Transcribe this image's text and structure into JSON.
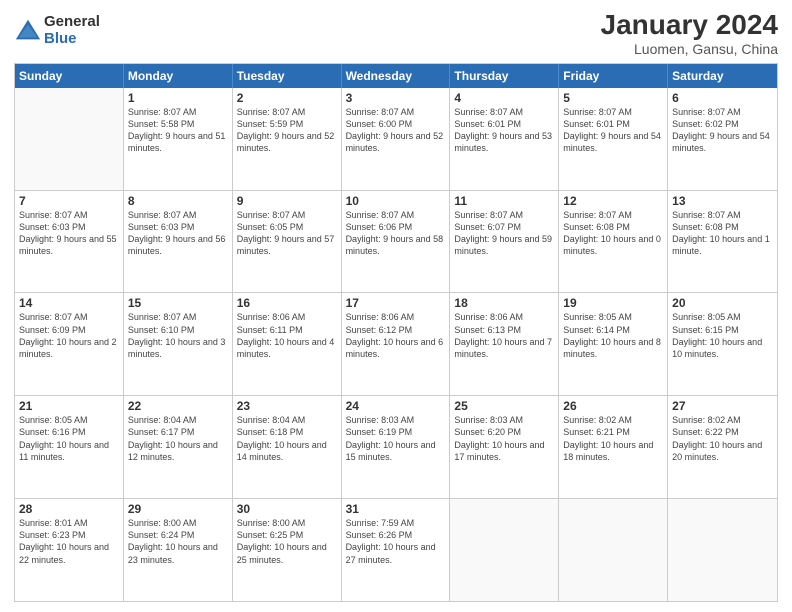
{
  "logo": {
    "general": "General",
    "blue": "Blue"
  },
  "header": {
    "title": "January 2024",
    "location": "Luomen, Gansu, China"
  },
  "days_of_week": [
    "Sunday",
    "Monday",
    "Tuesday",
    "Wednesday",
    "Thursday",
    "Friday",
    "Saturday"
  ],
  "weeks": [
    [
      {
        "day": "",
        "sunrise": "",
        "sunset": "",
        "daylight": "",
        "empty": true
      },
      {
        "day": "1",
        "sunrise": "Sunrise: 8:07 AM",
        "sunset": "Sunset: 5:58 PM",
        "daylight": "Daylight: 9 hours and 51 minutes."
      },
      {
        "day": "2",
        "sunrise": "Sunrise: 8:07 AM",
        "sunset": "Sunset: 5:59 PM",
        "daylight": "Daylight: 9 hours and 52 minutes."
      },
      {
        "day": "3",
        "sunrise": "Sunrise: 8:07 AM",
        "sunset": "Sunset: 6:00 PM",
        "daylight": "Daylight: 9 hours and 52 minutes."
      },
      {
        "day": "4",
        "sunrise": "Sunrise: 8:07 AM",
        "sunset": "Sunset: 6:01 PM",
        "daylight": "Daylight: 9 hours and 53 minutes."
      },
      {
        "day": "5",
        "sunrise": "Sunrise: 8:07 AM",
        "sunset": "Sunset: 6:01 PM",
        "daylight": "Daylight: 9 hours and 54 minutes."
      },
      {
        "day": "6",
        "sunrise": "Sunrise: 8:07 AM",
        "sunset": "Sunset: 6:02 PM",
        "daylight": "Daylight: 9 hours and 54 minutes."
      }
    ],
    [
      {
        "day": "7",
        "sunrise": "Sunrise: 8:07 AM",
        "sunset": "Sunset: 6:03 PM",
        "daylight": "Daylight: 9 hours and 55 minutes."
      },
      {
        "day": "8",
        "sunrise": "Sunrise: 8:07 AM",
        "sunset": "Sunset: 6:03 PM",
        "daylight": "Daylight: 9 hours and 56 minutes."
      },
      {
        "day": "9",
        "sunrise": "Sunrise: 8:07 AM",
        "sunset": "Sunset: 6:05 PM",
        "daylight": "Daylight: 9 hours and 57 minutes."
      },
      {
        "day": "10",
        "sunrise": "Sunrise: 8:07 AM",
        "sunset": "Sunset: 6:06 PM",
        "daylight": "Daylight: 9 hours and 58 minutes."
      },
      {
        "day": "11",
        "sunrise": "Sunrise: 8:07 AM",
        "sunset": "Sunset: 6:07 PM",
        "daylight": "Daylight: 9 hours and 59 minutes."
      },
      {
        "day": "12",
        "sunrise": "Sunrise: 8:07 AM",
        "sunset": "Sunset: 6:08 PM",
        "daylight": "Daylight: 10 hours and 0 minutes."
      },
      {
        "day": "13",
        "sunrise": "Sunrise: 8:07 AM",
        "sunset": "Sunset: 6:08 PM",
        "daylight": "Daylight: 10 hours and 1 minute."
      }
    ],
    [
      {
        "day": "14",
        "sunrise": "Sunrise: 8:07 AM",
        "sunset": "Sunset: 6:09 PM",
        "daylight": "Daylight: 10 hours and 2 minutes."
      },
      {
        "day": "15",
        "sunrise": "Sunrise: 8:07 AM",
        "sunset": "Sunset: 6:10 PM",
        "daylight": "Daylight: 10 hours and 3 minutes."
      },
      {
        "day": "16",
        "sunrise": "Sunrise: 8:06 AM",
        "sunset": "Sunset: 6:11 PM",
        "daylight": "Daylight: 10 hours and 4 minutes."
      },
      {
        "day": "17",
        "sunrise": "Sunrise: 8:06 AM",
        "sunset": "Sunset: 6:12 PM",
        "daylight": "Daylight: 10 hours and 6 minutes."
      },
      {
        "day": "18",
        "sunrise": "Sunrise: 8:06 AM",
        "sunset": "Sunset: 6:13 PM",
        "daylight": "Daylight: 10 hours and 7 minutes."
      },
      {
        "day": "19",
        "sunrise": "Sunrise: 8:05 AM",
        "sunset": "Sunset: 6:14 PM",
        "daylight": "Daylight: 10 hours and 8 minutes."
      },
      {
        "day": "20",
        "sunrise": "Sunrise: 8:05 AM",
        "sunset": "Sunset: 6:15 PM",
        "daylight": "Daylight: 10 hours and 10 minutes."
      }
    ],
    [
      {
        "day": "21",
        "sunrise": "Sunrise: 8:05 AM",
        "sunset": "Sunset: 6:16 PM",
        "daylight": "Daylight: 10 hours and 11 minutes."
      },
      {
        "day": "22",
        "sunrise": "Sunrise: 8:04 AM",
        "sunset": "Sunset: 6:17 PM",
        "daylight": "Daylight: 10 hours and 12 minutes."
      },
      {
        "day": "23",
        "sunrise": "Sunrise: 8:04 AM",
        "sunset": "Sunset: 6:18 PM",
        "daylight": "Daylight: 10 hours and 14 minutes."
      },
      {
        "day": "24",
        "sunrise": "Sunrise: 8:03 AM",
        "sunset": "Sunset: 6:19 PM",
        "daylight": "Daylight: 10 hours and 15 minutes."
      },
      {
        "day": "25",
        "sunrise": "Sunrise: 8:03 AM",
        "sunset": "Sunset: 6:20 PM",
        "daylight": "Daylight: 10 hours and 17 minutes."
      },
      {
        "day": "26",
        "sunrise": "Sunrise: 8:02 AM",
        "sunset": "Sunset: 6:21 PM",
        "daylight": "Daylight: 10 hours and 18 minutes."
      },
      {
        "day": "27",
        "sunrise": "Sunrise: 8:02 AM",
        "sunset": "Sunset: 6:22 PM",
        "daylight": "Daylight: 10 hours and 20 minutes."
      }
    ],
    [
      {
        "day": "28",
        "sunrise": "Sunrise: 8:01 AM",
        "sunset": "Sunset: 6:23 PM",
        "daylight": "Daylight: 10 hours and 22 minutes."
      },
      {
        "day": "29",
        "sunrise": "Sunrise: 8:00 AM",
        "sunset": "Sunset: 6:24 PM",
        "daylight": "Daylight: 10 hours and 23 minutes."
      },
      {
        "day": "30",
        "sunrise": "Sunrise: 8:00 AM",
        "sunset": "Sunset: 6:25 PM",
        "daylight": "Daylight: 10 hours and 25 minutes."
      },
      {
        "day": "31",
        "sunrise": "Sunrise: 7:59 AM",
        "sunset": "Sunset: 6:26 PM",
        "daylight": "Daylight: 10 hours and 27 minutes."
      },
      {
        "day": "",
        "sunrise": "",
        "sunset": "",
        "daylight": "",
        "empty": true
      },
      {
        "day": "",
        "sunrise": "",
        "sunset": "",
        "daylight": "",
        "empty": true
      },
      {
        "day": "",
        "sunrise": "",
        "sunset": "",
        "daylight": "",
        "empty": true
      }
    ]
  ]
}
